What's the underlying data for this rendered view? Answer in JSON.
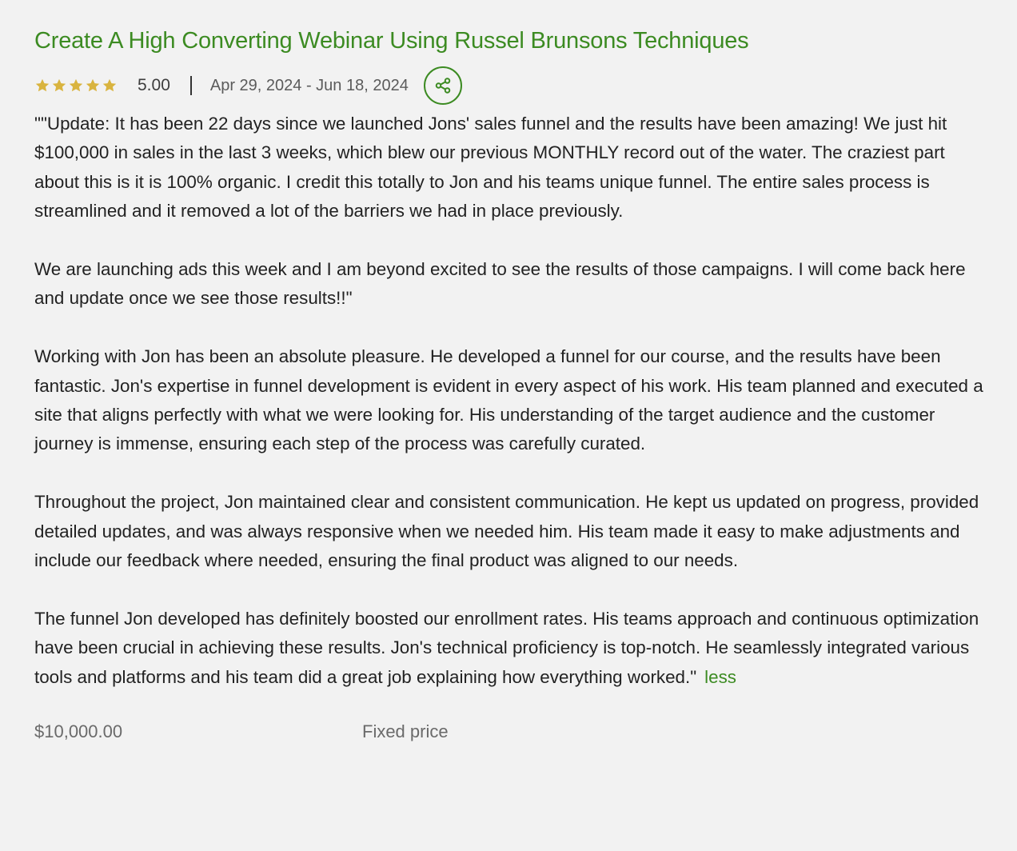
{
  "job": {
    "title": "Create A High Converting Webinar Using Russel Brunsons Techniques",
    "rating": "5.00",
    "star_count": 5,
    "star_color": "#d9b43f",
    "dates": "Apr 29, 2024 - Jun 18, 2024",
    "share_icon": "share-icon",
    "accent_color": "#3c8b22"
  },
  "review": {
    "paragraphs": [
      "\"\"Update: It has been 22 days since we launched Jons' sales funnel and the results have been amazing! We just hit $100,000 in sales in the last 3 weeks, which blew our previous MONTHLY record out of the water. The craziest part about this is it is 100% organic. I credit this totally to Jon and his teams unique funnel. The entire sales process is streamlined and it removed a lot of the barriers we had in place previously.",
      "We are launching ads this week and I am beyond excited to see the results of those campaigns. I will come back here and update once we see those results!!\"",
      "Working with Jon has been an absolute pleasure. He developed a funnel for our course, and the results have been fantastic. Jon's expertise in funnel development is evident in every aspect of his work. His team planned and executed a site that aligns perfectly with what we were looking for. His understanding of the target audience and the customer journey is immense, ensuring each step of the process was carefully curated.",
      "Throughout the project, Jon maintained clear and consistent communication. He kept us updated on progress, provided detailed updates, and was always responsive when we needed him. His team made it easy to make adjustments and include our feedback where needed, ensuring the final product was aligned to our needs.",
      "The funnel Jon developed has definitely boosted our enrollment rates. His teams approach and continuous optimization have been crucial in achieving these results. Jon's technical proficiency is top-notch. He seamlessly integrated various tools and platforms and his team did a great job explaining how everything worked.\""
    ],
    "less_label": "less"
  },
  "footer": {
    "price": "$10,000.00",
    "price_type": "Fixed price"
  }
}
